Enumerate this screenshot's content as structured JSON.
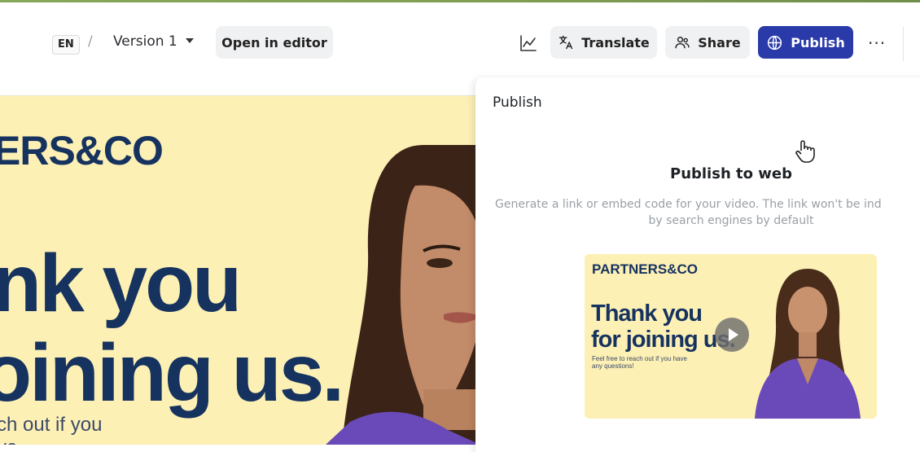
{
  "toolbar": {
    "language": "EN",
    "separator": "/",
    "version": "Version 1",
    "open_editor": "Open in editor",
    "translate": "Translate",
    "share": "Share",
    "publish": "Publish",
    "more": "···"
  },
  "canvas": {
    "brand": "ERS&CO",
    "headline_line1": "nk you",
    "headline_line2": "oining us.",
    "subtext_line1": "ch out if you",
    "subtext_line2": "ve"
  },
  "panel": {
    "title": "Publish",
    "heading": "Publish to web",
    "description_line1": "Generate a link or embed code for your video. The link won't be ind",
    "description_line2": "by search engines by default",
    "thumbnail": {
      "brand": "PARTNERS&CO",
      "headline_line1": "Thank you",
      "headline_line2": "for joining us.",
      "subtext": "Feel free to reach out if you have any questions!"
    }
  },
  "colors": {
    "publish_button": "#2a3aa8",
    "brand_navy": "#16335f",
    "canvas_bg": "#fdf0b5",
    "dress_purple": "#6a4ab8"
  }
}
